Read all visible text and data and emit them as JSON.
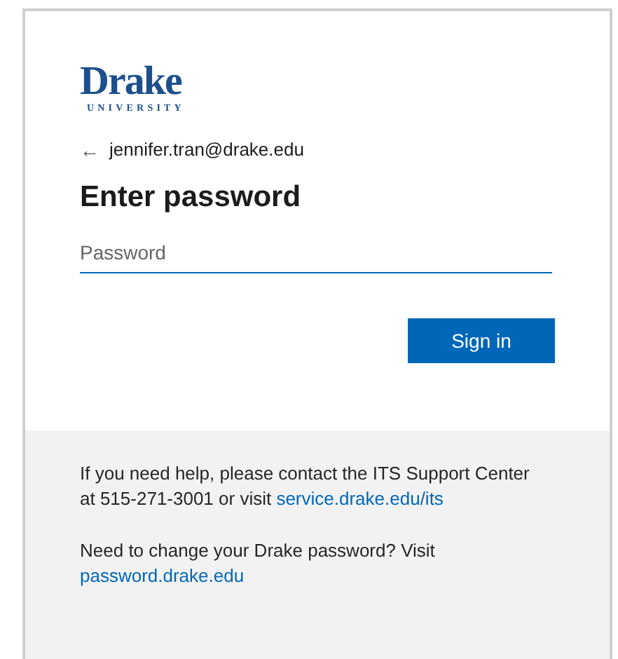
{
  "logo": {
    "name": "Drake",
    "subtitle": "UNIVERSITY"
  },
  "back": {
    "icon": "←",
    "email": "jennifer.tran@drake.edu"
  },
  "heading": "Enter password",
  "password_field": {
    "placeholder": "Password"
  },
  "sign_in_button": "Sign in",
  "help": [
    {
      "text": "If you need help, please contact the ITS Support Center at 515-271-3001 or visit",
      "link": "service.drake.edu/its"
    },
    {
      "text": "Need to change your Drake password? Visit",
      "link": "password.drake.edu"
    }
  ]
}
